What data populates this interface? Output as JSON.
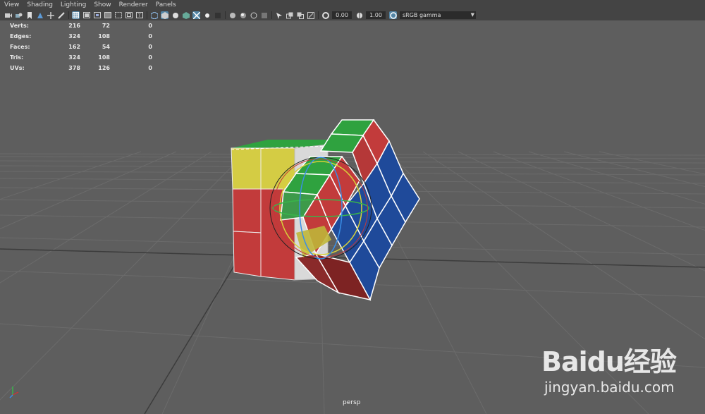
{
  "menu": [
    "View",
    "Shading",
    "Lighting",
    "Show",
    "Renderer",
    "Panels"
  ],
  "toolbar": {
    "exposure_value": "0.00",
    "gamma_value": "1.00",
    "colorspace": "sRGB gamma"
  },
  "hud": {
    "rows": [
      {
        "label": "Verts:",
        "a": "216",
        "b": "72",
        "c": "0"
      },
      {
        "label": "Edges:",
        "a": "324",
        "b": "108",
        "c": "0"
      },
      {
        "label": "Faces:",
        "a": "162",
        "b": "54",
        "c": "0"
      },
      {
        "label": "Tris:",
        "a": "324",
        "b": "108",
        "c": "0"
      },
      {
        "label": "UVs:",
        "a": "378",
        "b": "126",
        "c": "0"
      }
    ]
  },
  "viewport": {
    "camera": "persp"
  },
  "watermark": {
    "brand": "Baidu经验",
    "url": "jingyan.baidu.com"
  },
  "colors": {
    "background": "#5e5e5e",
    "grid": "#6e6e6e",
    "red": "#c23b3b",
    "green": "#2fa23f",
    "blue": "#1f4a9a",
    "yellow": "#d4cc44",
    "white": "#d9d9d9",
    "highlight": "#5285a6"
  }
}
